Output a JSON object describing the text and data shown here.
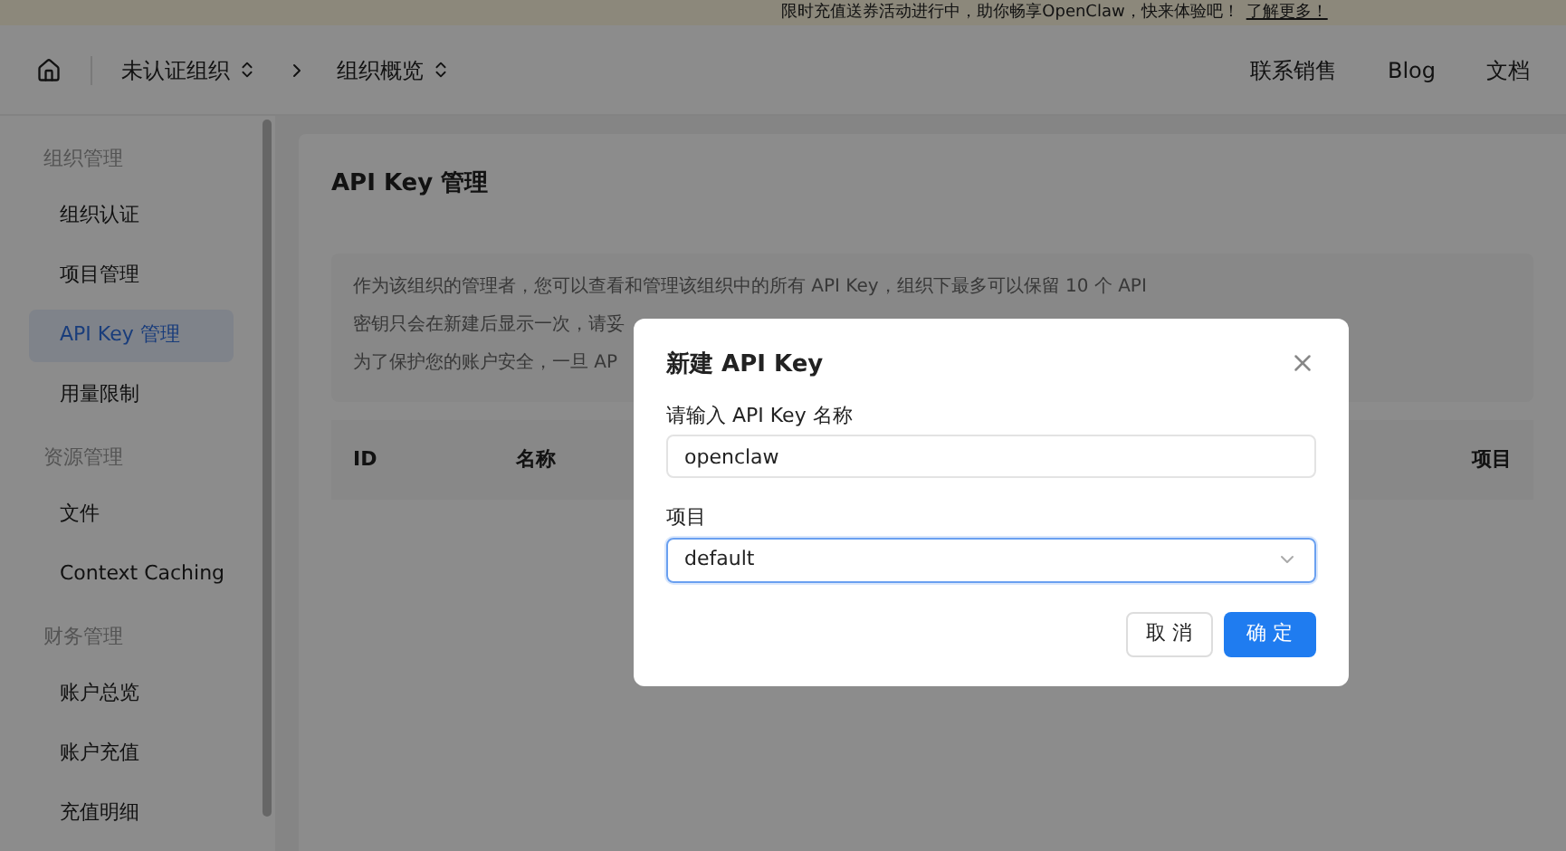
{
  "banner": {
    "text": "限时充值送券活动进行中，助你畅享OpenClaw，快来体验吧！",
    "link": "了解更多！"
  },
  "nav": {
    "org": "未认证组织",
    "page": "组织概览",
    "links": [
      "联系销售",
      "Blog",
      "文档"
    ]
  },
  "sidebar": {
    "groups": [
      {
        "title": "组织管理",
        "items": [
          {
            "label": "组织认证",
            "selected": false
          },
          {
            "label": "项目管理",
            "selected": false
          },
          {
            "label": "API Key 管理",
            "selected": true
          },
          {
            "label": "用量限制",
            "selected": false
          }
        ]
      },
      {
        "title": "资源管理",
        "items": [
          {
            "label": "文件",
            "selected": false
          },
          {
            "label": "Context Caching",
            "selected": false
          }
        ]
      },
      {
        "title": "财务管理",
        "items": [
          {
            "label": "账户总览",
            "selected": false
          },
          {
            "label": "账户充值",
            "selected": false
          },
          {
            "label": "充值明细",
            "selected": false
          }
        ]
      }
    ]
  },
  "page": {
    "title": "API Key 管理",
    "notice": [
      "作为该组织的管理者，您可以查看和管理该组织中的所有 API Key，组织下最多可以保留 10 个 API",
      "密钥只会在新建后显示一次，请妥",
      "为了保护您的账户安全，一旦 AP"
    ],
    "table": {
      "columns": [
        "ID",
        "名称",
        "项目"
      ]
    }
  },
  "dialog": {
    "title": "新建 API Key",
    "name_label": "请输入 API Key 名称",
    "name_value": "openclaw",
    "project_label": "项目",
    "project_value": "default",
    "project_focused": true,
    "buttons": [
      "取 消",
      "确 定"
    ]
  }
}
